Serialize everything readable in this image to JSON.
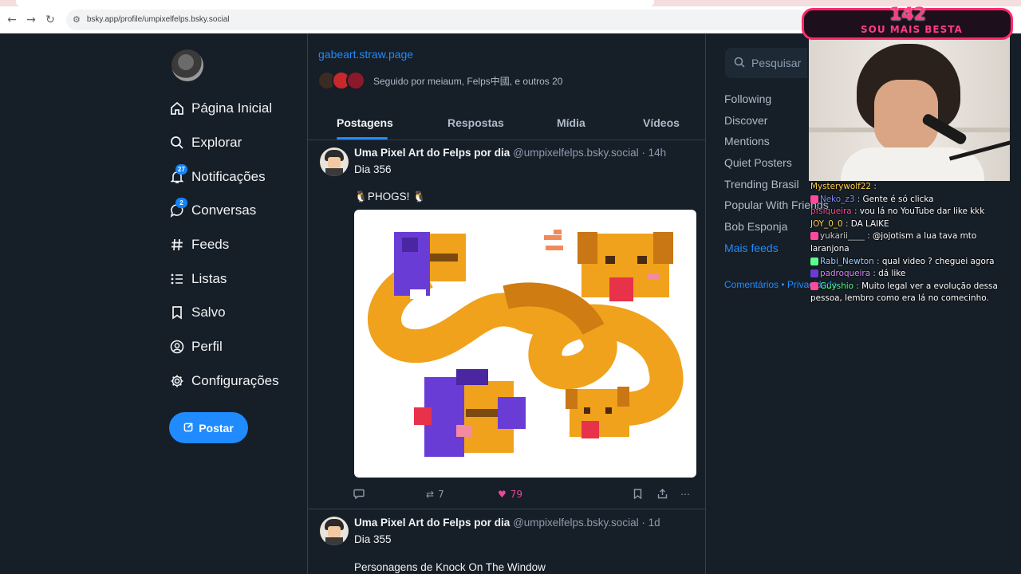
{
  "browser": {
    "url": "bsky.app/profile/umpixelfelps.bsky.social"
  },
  "nav": {
    "items": [
      {
        "label": "Página Inicial",
        "icon": "home-icon"
      },
      {
        "label": "Explorar",
        "icon": "search-icon"
      },
      {
        "label": "Notificações",
        "icon": "bell-icon",
        "badge": "27"
      },
      {
        "label": "Conversas",
        "icon": "chat-icon",
        "badge": "2"
      },
      {
        "label": "Feeds",
        "icon": "hash-icon"
      },
      {
        "label": "Listas",
        "icon": "list-icon"
      },
      {
        "label": "Salvo",
        "icon": "bookmark-icon"
      },
      {
        "label": "Perfil",
        "icon": "user-icon"
      },
      {
        "label": "Configurações",
        "icon": "gear-icon"
      }
    ],
    "post_button": "Postar"
  },
  "profile": {
    "link": "gabeart.straw.page",
    "followed_by": "Seguido por meiaum, Felps中國, e outros 20",
    "tabs": [
      "Postagens",
      "Respostas",
      "Mídia",
      "Vídeos"
    ],
    "active_tab": "Postagens"
  },
  "posts": [
    {
      "author": "Uma Pixel Art do Felps por dia",
      "meta": "@umpixelfelps.bsky.social · 14h",
      "line1": "Dia 356",
      "line2": "PHOGS!",
      "reposts": "7",
      "likes": "79"
    },
    {
      "author": "Uma Pixel Art do Felps por dia",
      "meta": "@umpixelfelps.bsky.social · 1d",
      "line1": "Dia 355",
      "line2": "Personagens de Knock On The Window"
    }
  ],
  "right": {
    "search_placeholder": "Pesquisar",
    "feeds": [
      "Following",
      "Discover",
      "Mentions",
      "Quiet Posters",
      "Trending Brasil",
      "Popular With Friends",
      "Bob Esponja",
      "Mais feeds"
    ],
    "footer": "Comentários • Privacidade"
  },
  "stream": {
    "banner_number": "142",
    "banner_text": "SOU MAIS BESTA",
    "chat": [
      {
        "user": "Mysterywolf22",
        "color": "#ffd24a",
        "msg": ""
      },
      {
        "user": "Neko_z3",
        "color": "#7f8cff",
        "msg": "Gente é só clicka"
      },
      {
        "user": "pfsiqueira",
        "color": "#ff4a9c",
        "msg": "vou lá no YouTube dar like kkk"
      },
      {
        "user": "JOY_0_0",
        "color": "#ffd24a",
        "msg": "DA LAIKE"
      },
      {
        "user": "yukarii____",
        "color": "#cfcfcf",
        "msg": "@jojotism a lua tava mto laranjona"
      },
      {
        "user": "Rabi_Newton",
        "color": "#9ad0ff",
        "msg": "qual video ? cheguei agora"
      },
      {
        "user": "padroqueira",
        "color": "#d58cff",
        "msg": "dá like"
      },
      {
        "user": "Guyshio",
        "color": "#5aff8c",
        "msg": "Muito legal ver a evolução dessa pessoa, lembro como era lá no comecinho."
      }
    ]
  },
  "colors": {
    "accent": "#208bfe",
    "like": "#ec4899",
    "background": "#161e27"
  }
}
